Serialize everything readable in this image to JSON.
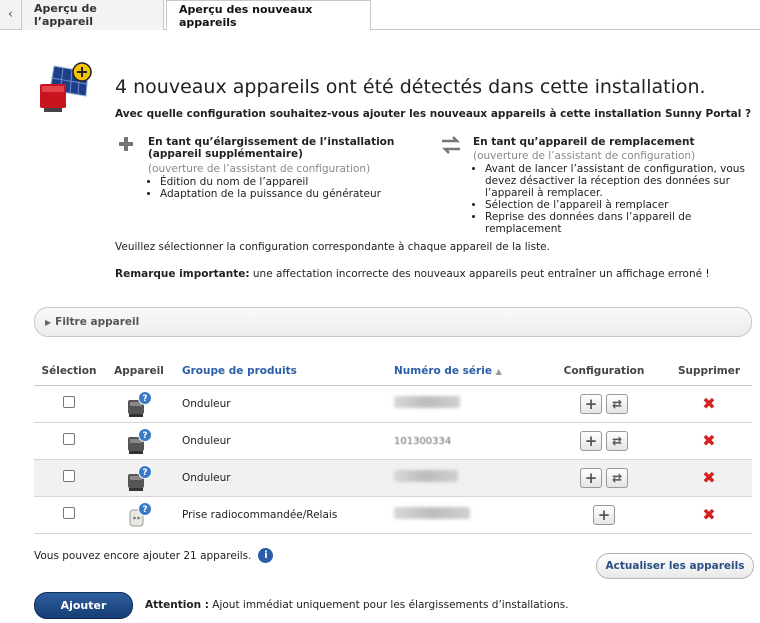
{
  "tabs": {
    "back": "‹",
    "tab1": "Aperçu de l’appareil",
    "tab2": "Aperçu des nouveaux appareils"
  },
  "headline": "4 nouveaux appareils ont été détectés dans cette installation.",
  "question": "Avec quelle configuration souhaitez-vous ajouter les nouveaux appareils à cette installation Sunny Portal ?",
  "option_extension": {
    "icon": "plus-icon",
    "title": "En tant qu’élargissement de l’installation (appareil supplémentaire)",
    "subtitle": "(ouverture de l’assistant de configuration)",
    "bullets": [
      "Édition du nom de l’appareil",
      "Adaptation de la puissance du générateur"
    ]
  },
  "option_replacement": {
    "icon": "swap-icon",
    "title": "En tant qu’appareil de remplacement",
    "subtitle": "(ouverture de l’assistant de configuration)",
    "bullets": [
      "Avant de lancer l’assistant de configuration, vous devez désactiver la réception des données sur l’appareil à remplacer.",
      "Sélection de l’appareil à remplacer",
      "Reprise des données dans l’appareil de remplacement"
    ]
  },
  "instruction": "Veuillez sélectionner la configuration correspondante à chaque appareil de la liste.",
  "remark": {
    "label": "Remarque importante:",
    "text": " une affectation incorrecte des nouveaux appareils peut entraîner un affichage erroné !"
  },
  "filter": {
    "label": "Filtre appareil"
  },
  "table": {
    "headers": {
      "selection": "Sélection",
      "device": "Appareil",
      "group": "Groupe de produits",
      "serial": "Numéro de série",
      "sort_indicator": "▲",
      "configuration": "Configuration",
      "delete": "Supprimer"
    },
    "rows": [
      {
        "group": "Onduleur",
        "serial_visible": "",
        "device_icon": "inverter-icon",
        "config": [
          "plus",
          "swap"
        ]
      },
      {
        "group": "Onduleur",
        "serial_visible": "101300334",
        "device_icon": "inverter-icon",
        "config": [
          "plus",
          "swap"
        ]
      },
      {
        "group": "Onduleur",
        "serial_visible": "",
        "device_icon": "inverter-icon",
        "config": [
          "plus",
          "swap"
        ]
      },
      {
        "group": "Prise radiocommandée/Relais",
        "serial_visible": "",
        "device_icon": "socket-icon",
        "config": [
          "plus"
        ]
      }
    ]
  },
  "remaining": "Vous pouvez encore ajouter 21 appareils.",
  "update_button": "Actualiser les appareils",
  "add_button": "Ajouter",
  "attention": {
    "label": "Attention :",
    "text": " Ajout immédiat uniquement pour les élargissements d’installations."
  },
  "colors": {
    "accent": "#2a5ea8",
    "primary_button": "#1f4d88",
    "delete": "#d42020",
    "row_alt": "#f1f1f1"
  }
}
